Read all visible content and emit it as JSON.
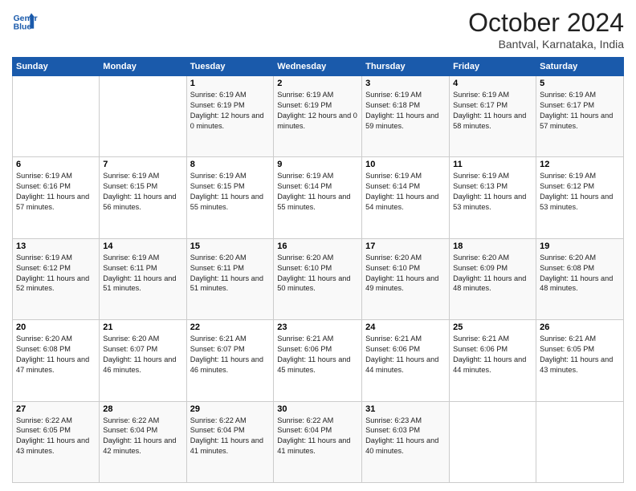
{
  "header": {
    "logo_line1": "General",
    "logo_line2": "Blue",
    "month": "October 2024",
    "location": "Bantval, Karnataka, India"
  },
  "weekdays": [
    "Sunday",
    "Monday",
    "Tuesday",
    "Wednesday",
    "Thursday",
    "Friday",
    "Saturday"
  ],
  "weeks": [
    [
      {
        "day": "",
        "info": ""
      },
      {
        "day": "",
        "info": ""
      },
      {
        "day": "1",
        "info": "Sunrise: 6:19 AM\nSunset: 6:19 PM\nDaylight: 12 hours and 0 minutes."
      },
      {
        "day": "2",
        "info": "Sunrise: 6:19 AM\nSunset: 6:19 PM\nDaylight: 12 hours and 0 minutes."
      },
      {
        "day": "3",
        "info": "Sunrise: 6:19 AM\nSunset: 6:18 PM\nDaylight: 11 hours and 59 minutes."
      },
      {
        "day": "4",
        "info": "Sunrise: 6:19 AM\nSunset: 6:17 PM\nDaylight: 11 hours and 58 minutes."
      },
      {
        "day": "5",
        "info": "Sunrise: 6:19 AM\nSunset: 6:17 PM\nDaylight: 11 hours and 57 minutes."
      }
    ],
    [
      {
        "day": "6",
        "info": "Sunrise: 6:19 AM\nSunset: 6:16 PM\nDaylight: 11 hours and 57 minutes."
      },
      {
        "day": "7",
        "info": "Sunrise: 6:19 AM\nSunset: 6:15 PM\nDaylight: 11 hours and 56 minutes."
      },
      {
        "day": "8",
        "info": "Sunrise: 6:19 AM\nSunset: 6:15 PM\nDaylight: 11 hours and 55 minutes."
      },
      {
        "day": "9",
        "info": "Sunrise: 6:19 AM\nSunset: 6:14 PM\nDaylight: 11 hours and 55 minutes."
      },
      {
        "day": "10",
        "info": "Sunrise: 6:19 AM\nSunset: 6:14 PM\nDaylight: 11 hours and 54 minutes."
      },
      {
        "day": "11",
        "info": "Sunrise: 6:19 AM\nSunset: 6:13 PM\nDaylight: 11 hours and 53 minutes."
      },
      {
        "day": "12",
        "info": "Sunrise: 6:19 AM\nSunset: 6:12 PM\nDaylight: 11 hours and 53 minutes."
      }
    ],
    [
      {
        "day": "13",
        "info": "Sunrise: 6:19 AM\nSunset: 6:12 PM\nDaylight: 11 hours and 52 minutes."
      },
      {
        "day": "14",
        "info": "Sunrise: 6:19 AM\nSunset: 6:11 PM\nDaylight: 11 hours and 51 minutes."
      },
      {
        "day": "15",
        "info": "Sunrise: 6:20 AM\nSunset: 6:11 PM\nDaylight: 11 hours and 51 minutes."
      },
      {
        "day": "16",
        "info": "Sunrise: 6:20 AM\nSunset: 6:10 PM\nDaylight: 11 hours and 50 minutes."
      },
      {
        "day": "17",
        "info": "Sunrise: 6:20 AM\nSunset: 6:10 PM\nDaylight: 11 hours and 49 minutes."
      },
      {
        "day": "18",
        "info": "Sunrise: 6:20 AM\nSunset: 6:09 PM\nDaylight: 11 hours and 48 minutes."
      },
      {
        "day": "19",
        "info": "Sunrise: 6:20 AM\nSunset: 6:08 PM\nDaylight: 11 hours and 48 minutes."
      }
    ],
    [
      {
        "day": "20",
        "info": "Sunrise: 6:20 AM\nSunset: 6:08 PM\nDaylight: 11 hours and 47 minutes."
      },
      {
        "day": "21",
        "info": "Sunrise: 6:20 AM\nSunset: 6:07 PM\nDaylight: 11 hours and 46 minutes."
      },
      {
        "day": "22",
        "info": "Sunrise: 6:21 AM\nSunset: 6:07 PM\nDaylight: 11 hours and 46 minutes."
      },
      {
        "day": "23",
        "info": "Sunrise: 6:21 AM\nSunset: 6:06 PM\nDaylight: 11 hours and 45 minutes."
      },
      {
        "day": "24",
        "info": "Sunrise: 6:21 AM\nSunset: 6:06 PM\nDaylight: 11 hours and 44 minutes."
      },
      {
        "day": "25",
        "info": "Sunrise: 6:21 AM\nSunset: 6:06 PM\nDaylight: 11 hours and 44 minutes."
      },
      {
        "day": "26",
        "info": "Sunrise: 6:21 AM\nSunset: 6:05 PM\nDaylight: 11 hours and 43 minutes."
      }
    ],
    [
      {
        "day": "27",
        "info": "Sunrise: 6:22 AM\nSunset: 6:05 PM\nDaylight: 11 hours and 43 minutes."
      },
      {
        "day": "28",
        "info": "Sunrise: 6:22 AM\nSunset: 6:04 PM\nDaylight: 11 hours and 42 minutes."
      },
      {
        "day": "29",
        "info": "Sunrise: 6:22 AM\nSunset: 6:04 PM\nDaylight: 11 hours and 41 minutes."
      },
      {
        "day": "30",
        "info": "Sunrise: 6:22 AM\nSunset: 6:04 PM\nDaylight: 11 hours and 41 minutes."
      },
      {
        "day": "31",
        "info": "Sunrise: 6:23 AM\nSunset: 6:03 PM\nDaylight: 11 hours and 40 minutes."
      },
      {
        "day": "",
        "info": ""
      },
      {
        "day": "",
        "info": ""
      }
    ]
  ]
}
